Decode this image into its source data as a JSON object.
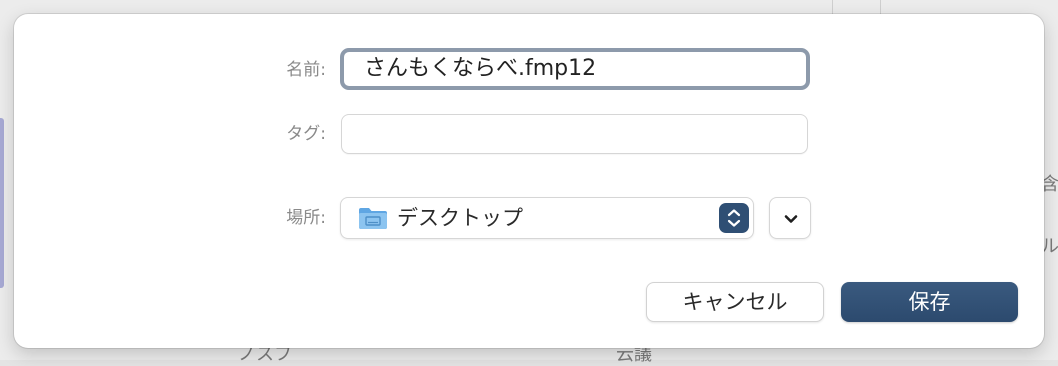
{
  "background_window": {
    "right_edge_texts": [
      "含",
      "ル"
    ],
    "bottom_texts": [
      "ノスフ",
      "云議"
    ]
  },
  "save_sheet": {
    "name_label": "名前:",
    "name_value": "さんもくならべ.fmp12",
    "tag_label": "タグ:",
    "tag_value": "",
    "location_label": "場所:",
    "location_value": "デスクトップ",
    "location_icon": "folder-icon",
    "stepper_icon": "up-down-chevron-icon",
    "expand_icon": "chevron-down-icon",
    "cancel_label": "キャンセル",
    "save_label": "保存"
  },
  "colors": {
    "accent": "#2f4f74",
    "focus_ring": "#8d9aab",
    "folder": "#6fb0e6"
  }
}
